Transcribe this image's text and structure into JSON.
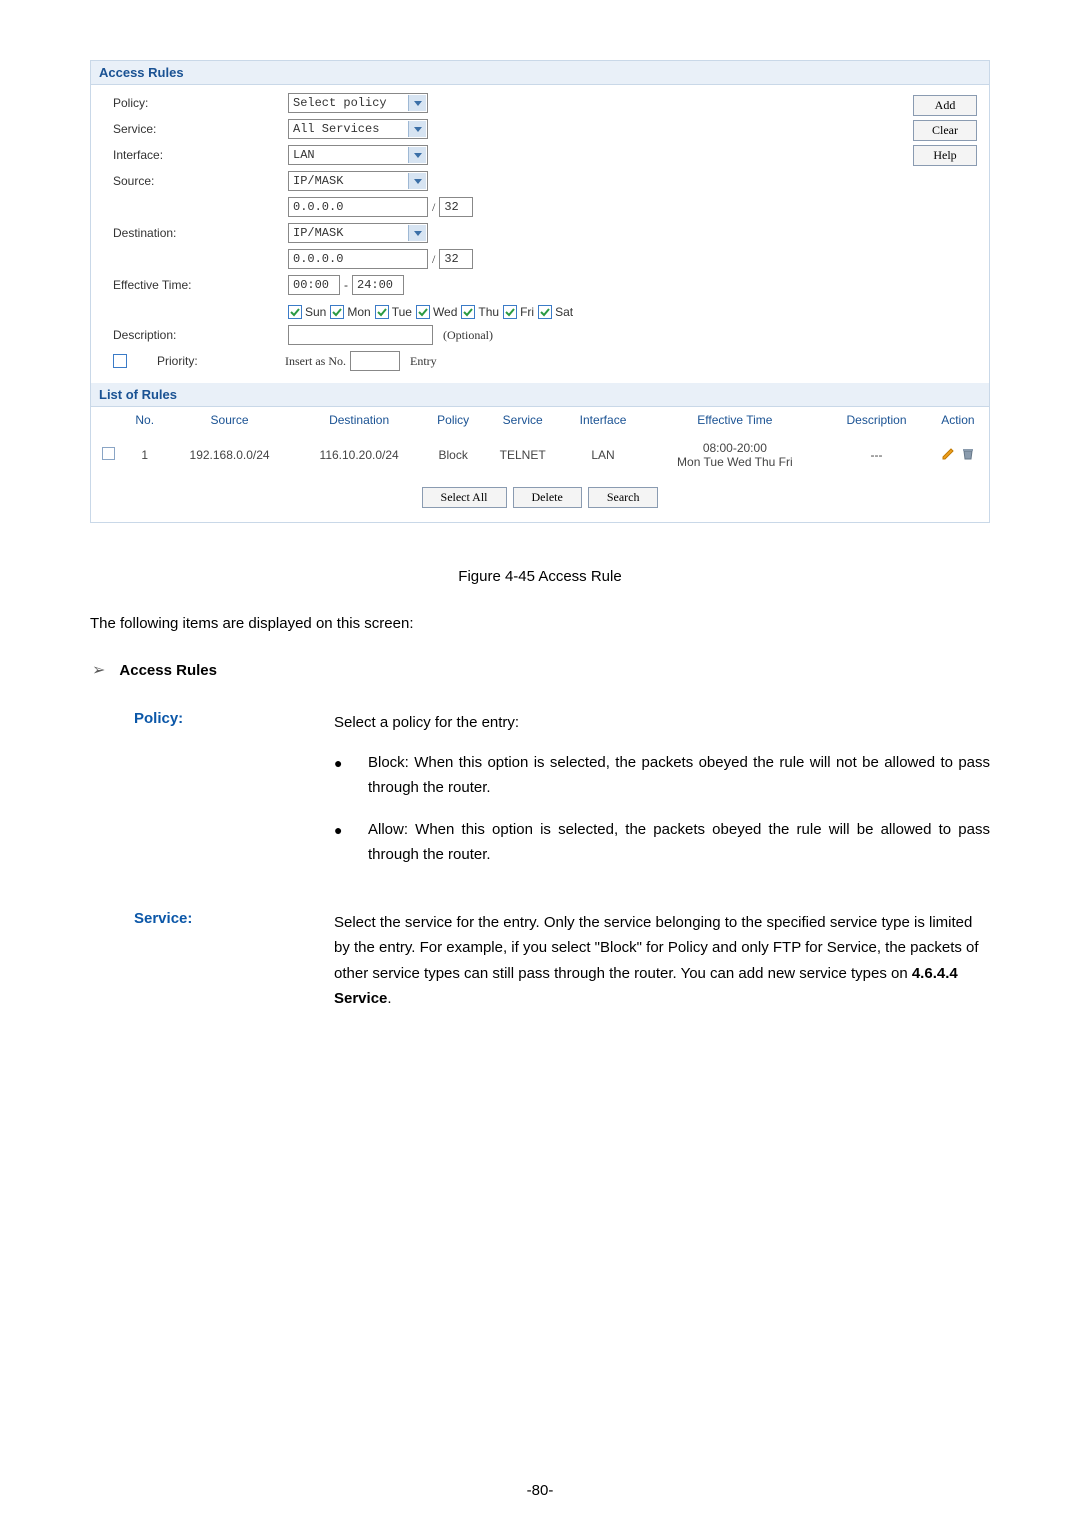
{
  "screenshot": {
    "section_access_rules": "Access Rules",
    "labels": {
      "policy": "Policy:",
      "service": "Service:",
      "interface": "Interface:",
      "source": "Source:",
      "destination": "Destination:",
      "effective_time": "Effective Time:",
      "description": "Description:",
      "priority": "Priority:"
    },
    "values": {
      "policy": "Select policy",
      "service": "All Services",
      "interface": "LAN",
      "source_mode": "IP/MASK",
      "source_ip": "0.0.0.0",
      "source_mask": "32",
      "dest_mode": "IP/MASK",
      "dest_ip": "0.0.0.0",
      "dest_mask": "32",
      "time_start": "00:00",
      "time_end": "24:00",
      "insert_label": "Insert as No.",
      "entry_label": "Entry",
      "optional": "(Optional)"
    },
    "days": [
      "Sun",
      "Mon",
      "Tue",
      "Wed",
      "Thu",
      "Fri",
      "Sat"
    ],
    "buttons": {
      "add": "Add",
      "clear": "Clear",
      "help": "Help",
      "select_all": "Select All",
      "delete": "Delete",
      "search": "Search"
    },
    "section_list": "List of Rules",
    "table": {
      "headers": {
        "no": "No.",
        "source": "Source",
        "destination": "Destination",
        "policy": "Policy",
        "service": "Service",
        "interface": "Interface",
        "effective_time": "Effective Time",
        "description": "Description",
        "action": "Action"
      },
      "rows": [
        {
          "no": "1",
          "source": "192.168.0.0/24",
          "destination": "116.10.20.0/24",
          "policy": "Block",
          "service": "TELNET",
          "interface": "LAN",
          "effective_time_1": "08:00-20:00",
          "effective_time_2": "Mon Tue Wed Thu Fri",
          "description": "---"
        }
      ]
    }
  },
  "doc": {
    "figure_caption": "Figure 4-45 Access Rule",
    "intro": "The following items are displayed on this screen:",
    "section_title": "Access Rules",
    "policy_label": "Policy:",
    "policy_intro": "Select a policy for the entry:",
    "policy_block": "Block: When this option is selected, the packets obeyed the rule will not be allowed to pass through the router.",
    "policy_allow": "Allow: When this option is selected, the packets obeyed the rule will be allowed to pass through the router.",
    "service_label": "Service:",
    "service_text_1": "Select the service for the entry. Only the service belonging to the specified service type is limited by the entry. For example, if you select \"Block\" for Policy and only FTP for Service, the packets of other service types can still pass through the router. You can add new service types on ",
    "service_text_bold": "4.6.4.4 Service",
    "service_text_2": ".",
    "page_number": "-80-"
  }
}
